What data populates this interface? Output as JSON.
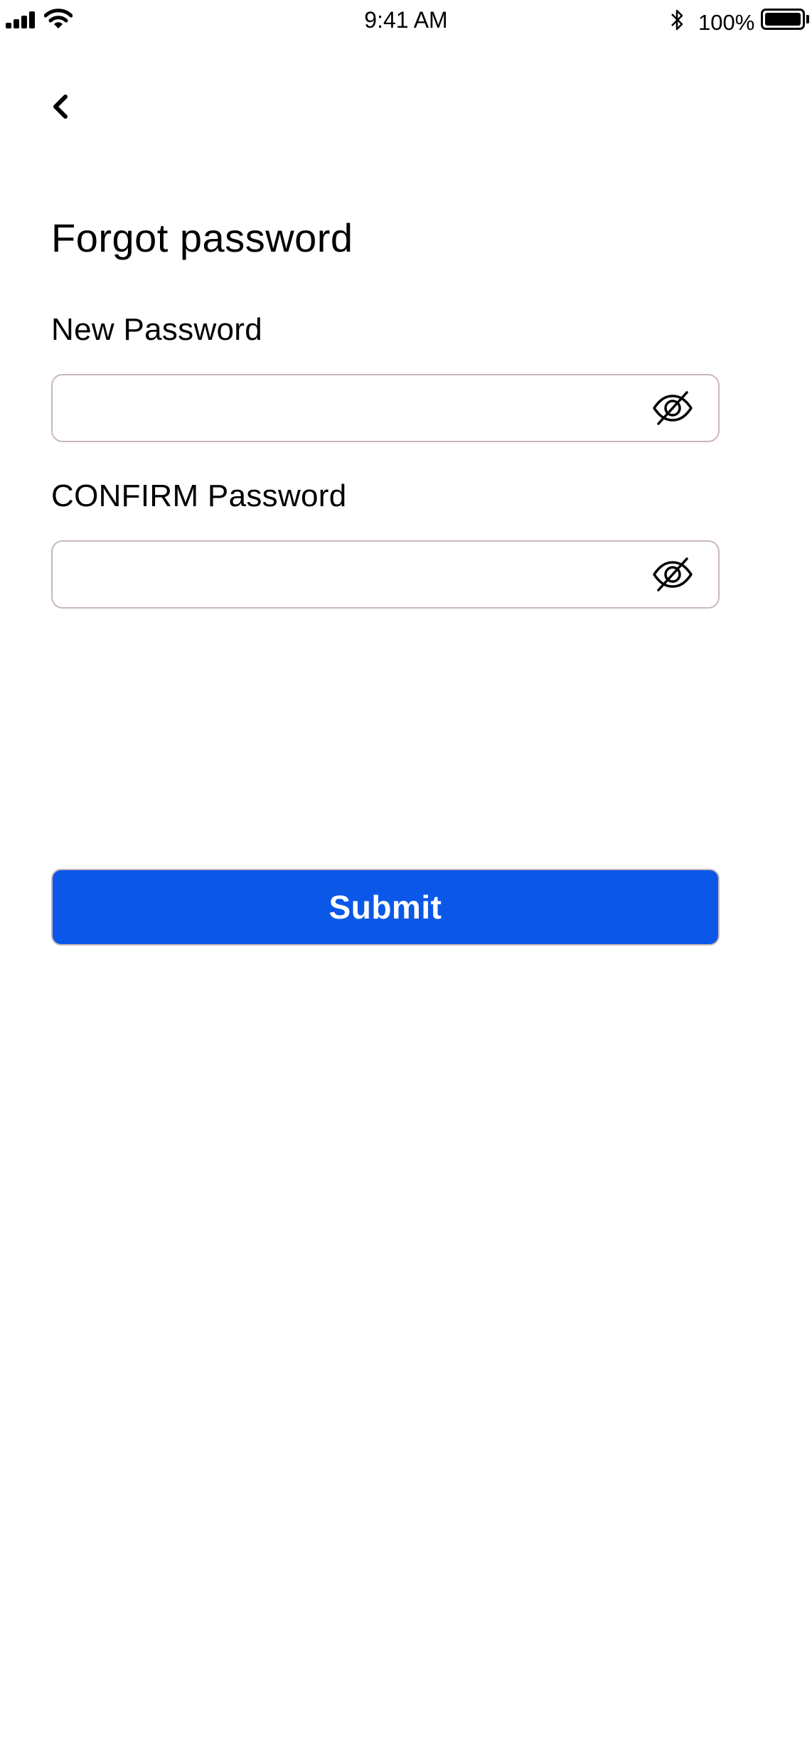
{
  "status_bar": {
    "time": "9:41 AM",
    "battery_percent": "100%",
    "battery_level": 1.0
  },
  "screen": {
    "title": "Forgot password",
    "back_icon": "chevron-left-icon"
  },
  "new_password": {
    "label": "New Password",
    "value": "",
    "placeholder": "",
    "toggle_icon": "eye-slash-icon"
  },
  "confirm_password": {
    "label": "CONFIRM Password",
    "value": "",
    "placeholder": "",
    "toggle_icon": "eye-slash-icon"
  },
  "submit": {
    "label": "Submit"
  },
  "colors": {
    "primary": "#0b57e8",
    "input_border": "#c9b7bb",
    "text": "#000000",
    "background": "#ffffff"
  }
}
